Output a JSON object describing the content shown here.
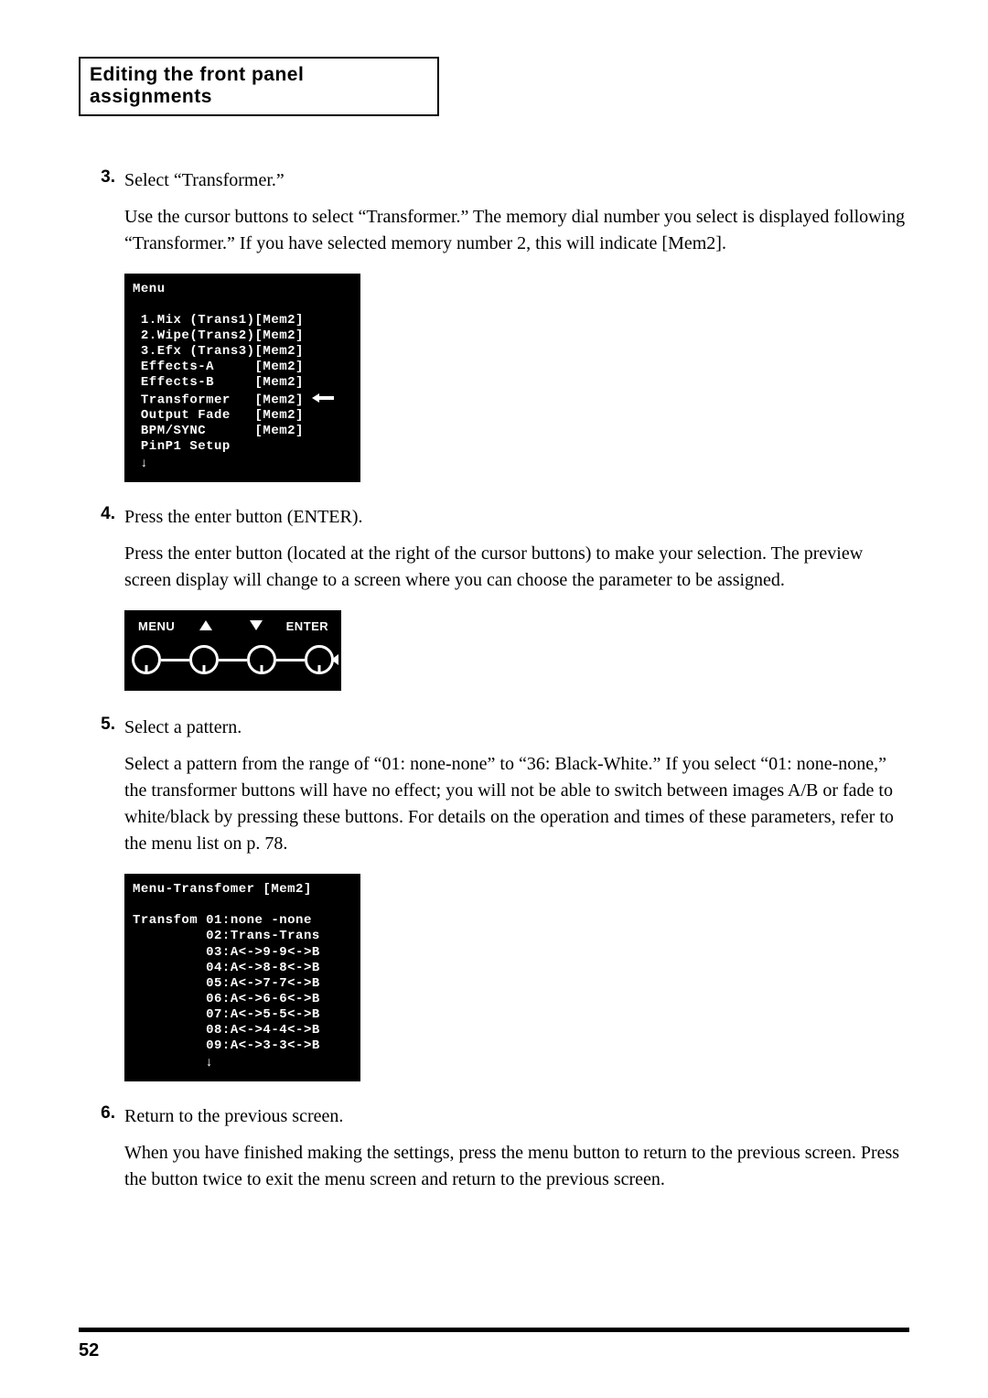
{
  "section_title": "Editing the front panel assignments",
  "steps": [
    {
      "num": "3.",
      "title": "Select “Transformer.”",
      "body": "Use the cursor buttons to select “Transformer.” The memory dial number you select is displayed following “Transformer.” If you have selected memory number 2, this will indicate [Mem2]."
    },
    {
      "num": "4.",
      "title": "Press the enter button (ENTER).",
      "body": "Press the enter button (located at the right of the cursor buttons) to make your selection. The preview screen display will change to a screen where you can choose the parameter to be assigned."
    },
    {
      "num": "5.",
      "title": "Select a pattern.",
      "body": "Select a pattern from the range of “01: none-none” to “36: Black-White.” If you select “01: none-none,” the transformer buttons will have no effect; you will not be able to switch between images A/B or fade to white/black by pressing these buttons. For details on the operation and times of these parameters, refer to the menu list on p. 78."
    },
    {
      "num": "6.",
      "title": "Return to the previous screen.",
      "body": "When you have finished making the settings, press the menu button to return to the previous screen. Press the button twice to exit the menu screen and return to the previous screen."
    }
  ],
  "menu1": {
    "header": "Menu",
    "lines": [
      "1.Mix (Trans1)[Mem2]",
      "2.Wipe(Trans2)[Mem2]",
      "3.Efx (Trans3)[Mem2]",
      "Effects-A     [Mem2]",
      "Effects-B     [Mem2]",
      "Transformer   [Mem2]",
      "Output Fade   [Mem2]",
      "BPM/SYNC      [Mem2]",
      "PinP1 Setup"
    ],
    "highlight_index": 5
  },
  "panel": {
    "menu": "MENU",
    "enter": "ENTER"
  },
  "menu2": {
    "header": "Menu-Transfomer [Mem2]",
    "label": "Transfom",
    "lines": [
      "01:none -none",
      "02:Trans-Trans",
      "03:A<->9-9<->B",
      "04:A<->8-8<->B",
      "05:A<->7-7<->B",
      "06:A<->6-6<->B",
      "07:A<->5-5<->B",
      "08:A<->4-4<->B",
      "09:A<->3-3<->B"
    ]
  },
  "page_number": "52"
}
